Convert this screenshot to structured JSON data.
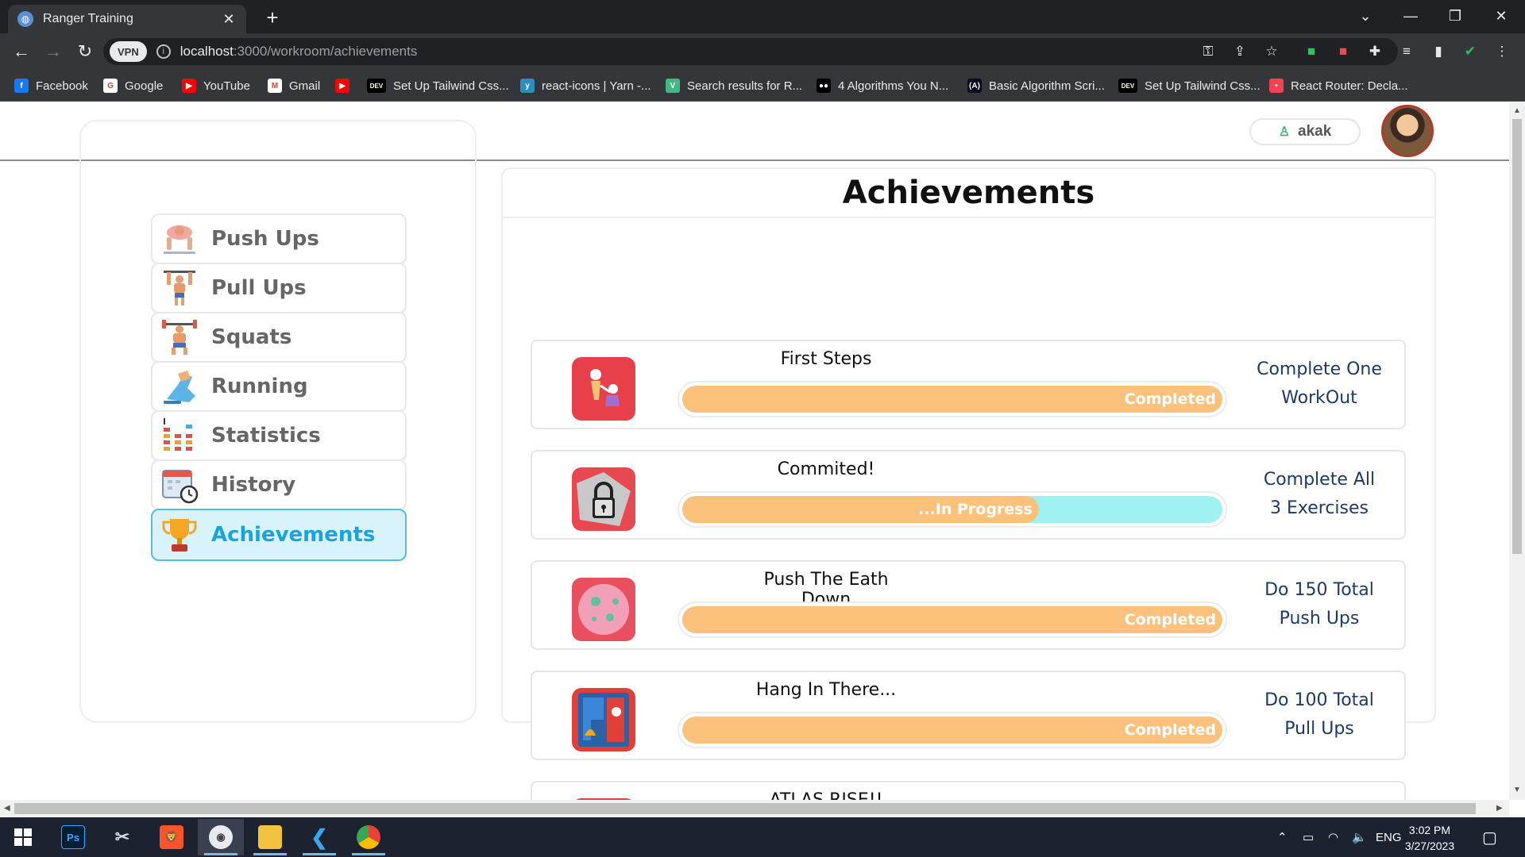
{
  "browser": {
    "tab_title": "Ranger Training",
    "url_host": "localhost",
    "url_path": ":3000/workroom/achievements",
    "vpn_label": "VPN",
    "bookmarks": [
      {
        "label": "Facebook",
        "icon": "facebook-icon",
        "color": "#1877f2",
        "glyph": "f"
      },
      {
        "label": "Google",
        "icon": "google-icon",
        "color": "#ffffff",
        "glyph": "G"
      },
      {
        "label": "YouTube",
        "icon": "youtube-icon",
        "color": "#ff0000",
        "glyph": "▶"
      },
      {
        "label": "Gmail",
        "icon": "gmail-icon",
        "color": "#ffffff",
        "glyph": "M"
      },
      {
        "label": "",
        "icon": "youtube-icon",
        "color": "#ff0000",
        "glyph": "▶"
      },
      {
        "label": "Set Up Tailwind Css...",
        "icon": "dev-icon",
        "color": "#000000",
        "glyph": "DEV"
      },
      {
        "label": "react-icons | Yarn -...",
        "icon": "yarn-icon",
        "color": "#2c8ebb",
        "glyph": "y"
      },
      {
        "label": "Search results for R...",
        "icon": "vue-icon",
        "color": "#41b883",
        "glyph": "V"
      },
      {
        "label": "4 Algorithms You N...",
        "icon": "medium-icon",
        "color": "#000000",
        "glyph": "●●"
      },
      {
        "label": "Basic Algorithm Scri...",
        "icon": "fcc-icon",
        "color": "#0a0a23",
        "glyph": "(A)"
      },
      {
        "label": "Set Up Tailwind Css...",
        "icon": "dev-icon",
        "color": "#000000",
        "glyph": "DEV"
      },
      {
        "label": "React Router: Decla...",
        "icon": "react-router-icon",
        "color": "#f44250",
        "glyph": "•"
      }
    ]
  },
  "user": {
    "name": "akak"
  },
  "sidebar": {
    "items": [
      {
        "label": "Push Ups",
        "icon": "pushups-icon",
        "active": false
      },
      {
        "label": "Pull Ups",
        "icon": "pullups-icon",
        "active": false
      },
      {
        "label": "Squats",
        "icon": "squats-icon",
        "active": false
      },
      {
        "label": "Running",
        "icon": "running-icon",
        "active": false
      },
      {
        "label": "Statistics",
        "icon": "statistics-icon",
        "active": false
      },
      {
        "label": "History",
        "icon": "history-icon",
        "active": false
      },
      {
        "label": "Achievements",
        "icon": "trophy-icon",
        "active": true
      }
    ]
  },
  "achievements": {
    "title": "Achievements",
    "items": [
      {
        "name": "First Steps",
        "status": "Completed",
        "progress": 1.0,
        "goal_line1": "Complete One",
        "goal_line2": "WorkOut",
        "icon": "first-steps-icon"
      },
      {
        "name": "Commited!",
        "status": "...In Progress",
        "progress": 0.66,
        "goal_line1": "Complete All",
        "goal_line2": "3 Exercises",
        "icon": "locked-badge-icon"
      },
      {
        "name": "Push The Eath Down",
        "status": "Completed",
        "progress": 1.0,
        "goal_line1": "Do 150 Total",
        "goal_line2": "Push Ups",
        "icon": "earth-badge-icon"
      },
      {
        "name": "Hang In There...",
        "status": "Completed",
        "progress": 1.0,
        "goal_line1": "Do 100 Total",
        "goal_line2": "Pull Ups",
        "icon": "hang-badge-icon"
      },
      {
        "name": "ATLAS RISE!!",
        "status": "",
        "progress": 0,
        "goal_line1": "",
        "goal_line2": "",
        "icon": "atlas-badge-icon"
      }
    ]
  },
  "taskbar": {
    "time": "3:02 PM",
    "date": "3/27/2023",
    "lang": "ENG"
  }
}
